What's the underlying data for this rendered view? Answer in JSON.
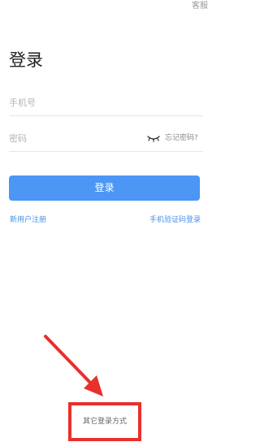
{
  "header": {
    "customer_service_label": "客服"
  },
  "title": "登录",
  "form": {
    "phone_placeholder": "手机号",
    "phone_value": "",
    "password_placeholder": "密码",
    "password_value": "",
    "forgot_password_label": "忘记密码?"
  },
  "login_button_label": "登录",
  "links": {
    "register_label": "新用户注册",
    "sms_login_label": "手机验证码登录"
  },
  "other_login_label": "其它登录方式",
  "colors": {
    "primary": "#4c96f6",
    "link": "#4a90e2",
    "annotation": "#e8302c"
  },
  "icons": {
    "password_visibility": "eye-closed-icon"
  }
}
